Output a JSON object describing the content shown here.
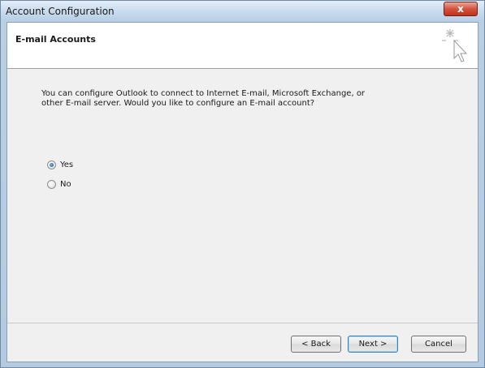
{
  "window": {
    "title": "Account Configuration",
    "close_glyph": "x"
  },
  "header": {
    "title": "E-mail Accounts",
    "icon": "sparkle-cursor-icon"
  },
  "body": {
    "intro": "You can configure Outlook to connect to Internet E-mail, Microsoft Exchange, or\nother E-mail server. Would you like to configure an E-mail account?",
    "options": [
      {
        "label": "Yes",
        "selected": true
      },
      {
        "label": "No",
        "selected": false
      }
    ]
  },
  "footer": {
    "back_label": "< Back",
    "next_label": "Next >",
    "cancel_label": "Cancel"
  },
  "colors": {
    "accent": "#3c7fb1",
    "close_button": "#c0321b"
  }
}
